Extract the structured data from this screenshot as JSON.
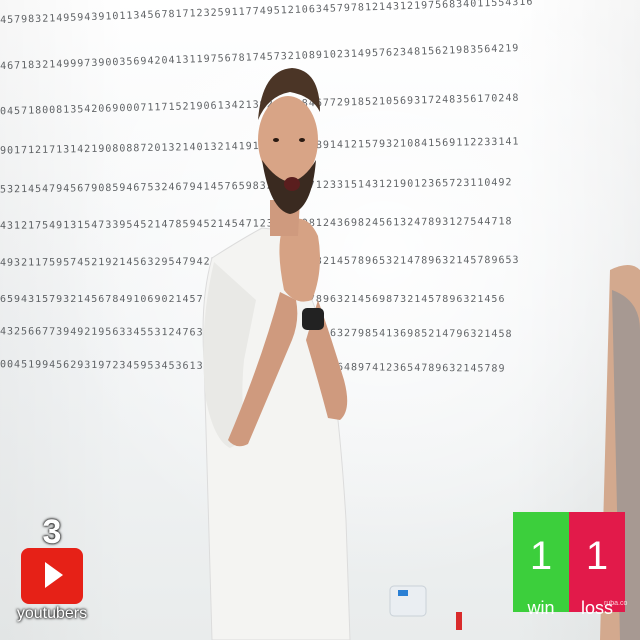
{
  "wall": {
    "rows": [
      "4579832149594391011345678171232591177495121063457978121431219756834011554316",
      "46718321499973900356942041311975678174573210891023149576234815621983564219",
      "04571800813542069000711715219061342139241358467729185210569317248356170248",
      "90171217131421908088720132140132141913456712289141215793210841569112233141",
      "5321454794567908594675324679414576598324615471233151431219012365723110492",
      "4312175491315473395452147859452145471234577981243698245613247893127544718",
      "49321175957452192145632954794221467953214789632145789653214789632145789653",
      "659431579321456784910690214576932146789321457896321456987321457896321456",
      "4325667739492195633455312476321469823147985214563279854136985214796321458",
      "004519945629319723459534536132145698732145987325648974123654789632145789"
    ]
  },
  "badge": {
    "count": "3",
    "label": "youtubers"
  },
  "scoreboard": {
    "win": {
      "count": "1",
      "label": "win",
      "color": "#3ccf3c"
    },
    "loss": {
      "count": "1",
      "label": "loss",
      "color": "#e21a4a"
    }
  },
  "watermark": "ruba.co"
}
